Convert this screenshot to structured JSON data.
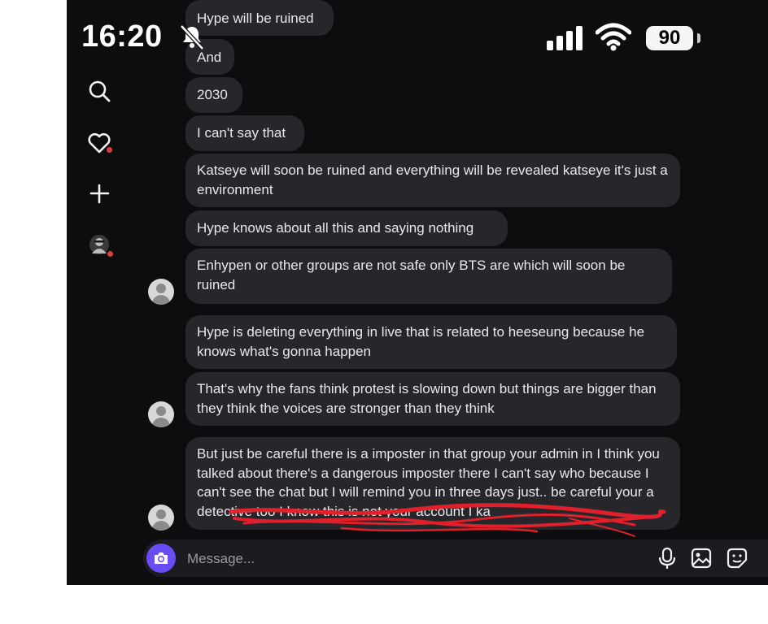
{
  "status_bar": {
    "time": "16:20",
    "battery": "90",
    "icons": [
      "bell-muted-icon",
      "cellular-signal-icon",
      "wifi-icon",
      "battery-icon"
    ]
  },
  "sidebar": {
    "icons": [
      "search-icon",
      "heart-icon",
      "plus-icon",
      "profile-avatar"
    ]
  },
  "messages": [
    "Hype will be ruined",
    "And",
    "2030",
    "I can't say that",
    "Katseye will soon be ruined and everything will be revealed katseye it's just a environment",
    "Hype knows about all this and saying nothing",
    "Enhypen or other groups are not safe only BTS are which will soon be ruined",
    "Hype is deleting everything in live that is related to heeseung because he knows what's gonna happen",
    "That's why the fans think protest is slowing down but things are bigger than they think the voices are stronger than they think",
    "But just be careful there is a imposter in that group your admin in I think you talked about there's a dangerous imposter there I can't say who because I can't see the chat but I will remind you in three days just.. be careful your a detective too I know this is not your account I ka"
  ],
  "composer": {
    "placeholder": "Message...",
    "accent_color": "#6a4cf5",
    "icons": [
      "camera-icon",
      "microphone-icon",
      "image-icon",
      "sticker-icon"
    ]
  },
  "colors": {
    "background": "#0d0d10",
    "bubble": "#26262b",
    "text": "#e9e9ec",
    "notification_dot": "#e23b3b",
    "scribble": "#e0202a"
  }
}
